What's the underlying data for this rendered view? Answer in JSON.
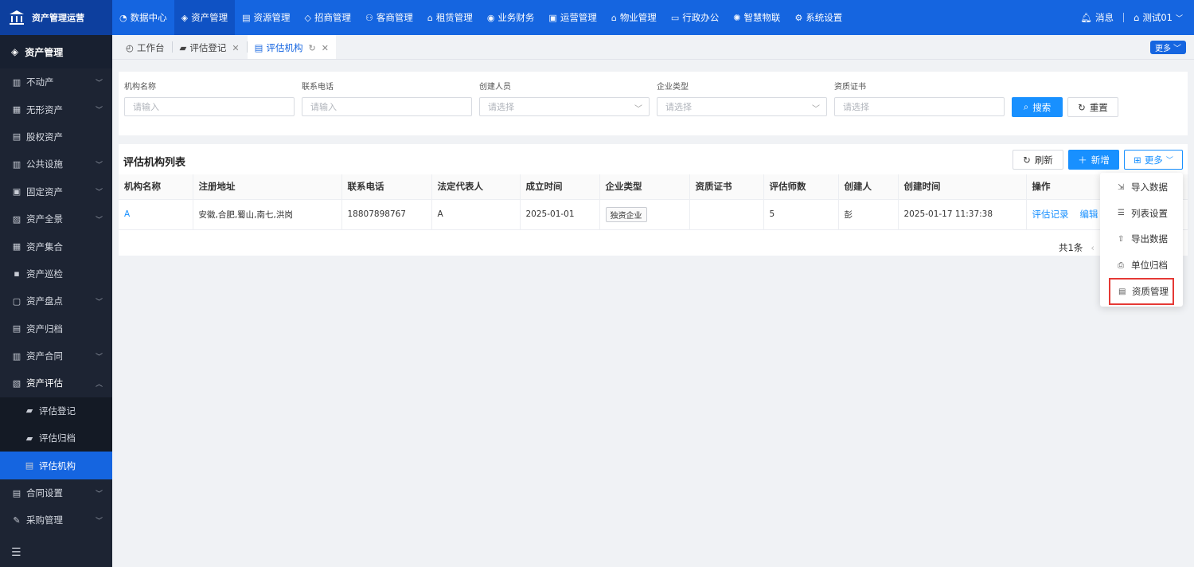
{
  "app": {
    "title": "资产管理运营"
  },
  "topnav": [
    {
      "label": "数据中心",
      "icon": "◔",
      "active": false
    },
    {
      "label": "资产管理",
      "icon": "◈",
      "active": true
    },
    {
      "label": "资源管理",
      "icon": "▤",
      "active": false
    },
    {
      "label": "招商管理",
      "icon": "◇",
      "active": false
    },
    {
      "label": "客商管理",
      "icon": "⚇",
      "active": false
    },
    {
      "label": "租赁管理",
      "icon": "⌂",
      "active": false
    },
    {
      "label": "业务财务",
      "icon": "◉",
      "active": false
    },
    {
      "label": "运营管理",
      "icon": "▣",
      "active": false
    },
    {
      "label": "物业管理",
      "icon": "⌂",
      "active": false
    },
    {
      "label": "行政办公",
      "icon": "▭",
      "active": false
    },
    {
      "label": "智慧物联",
      "icon": "✺",
      "active": false
    },
    {
      "label": "系统设置",
      "icon": "⚙",
      "active": false
    }
  ],
  "header_right": {
    "messages": "消息",
    "user": "测试01"
  },
  "sidebar": {
    "header": "资产管理",
    "items": [
      {
        "label": "不动产",
        "icon": "▥",
        "chevron": "﹀",
        "sub": false
      },
      {
        "label": "无形资产",
        "icon": "▦",
        "chevron": "﹀",
        "sub": false
      },
      {
        "label": "股权资产",
        "icon": "▤",
        "chevron": "",
        "sub": false
      },
      {
        "label": "公共设施",
        "icon": "▥",
        "chevron": "﹀",
        "sub": false
      },
      {
        "label": "固定资产",
        "icon": "▣",
        "chevron": "﹀",
        "sub": false
      },
      {
        "label": "资产全景",
        "icon": "▨",
        "chevron": "﹀",
        "sub": false
      },
      {
        "label": "资产集合",
        "icon": "▦",
        "chevron": "",
        "sub": false
      },
      {
        "label": "资产巡检",
        "icon": "▪",
        "chevron": "",
        "sub": false
      },
      {
        "label": "资产盘点",
        "icon": "▢",
        "chevron": "﹀",
        "sub": false
      },
      {
        "label": "资产归档",
        "icon": "▤",
        "chevron": "",
        "sub": false
      },
      {
        "label": "资产合同",
        "icon": "▥",
        "chevron": "﹀",
        "sub": false
      },
      {
        "label": "资产评估",
        "icon": "▧",
        "chevron": "︿",
        "sub": false,
        "open": true
      },
      {
        "label": "评估登记",
        "icon": "▰",
        "chevron": "",
        "sub": true
      },
      {
        "label": "评估归档",
        "icon": "▰",
        "chevron": "",
        "sub": true
      },
      {
        "label": "评估机构",
        "icon": "▤",
        "chevron": "",
        "sub": true,
        "active": true
      },
      {
        "label": "合同设置",
        "icon": "▤",
        "chevron": "﹀",
        "sub": false
      },
      {
        "label": "采购管理",
        "icon": "✎",
        "chevron": "﹀",
        "sub": false
      }
    ]
  },
  "tabs": [
    {
      "label": "工作台",
      "icon": "◴",
      "closable": false,
      "active": false
    },
    {
      "label": "评估登记",
      "icon": "▰",
      "closable": true,
      "active": false
    },
    {
      "label": "评估机构",
      "icon": "▤",
      "closable": true,
      "active": true
    }
  ],
  "tabbar_more": "更多",
  "search": {
    "fields": [
      {
        "label": "机构名称",
        "placeholder": "请输入",
        "select": false
      },
      {
        "label": "联系电话",
        "placeholder": "请输入",
        "select": false
      },
      {
        "label": "创建人员",
        "placeholder": "请选择",
        "select": true
      },
      {
        "label": "企业类型",
        "placeholder": "请选择",
        "select": true
      },
      {
        "label": "资质证书",
        "placeholder": "请选择",
        "select": false
      }
    ],
    "search_label": "搜索",
    "reset_label": "重置"
  },
  "list": {
    "title": "评估机构列表",
    "refresh_label": "刷新",
    "add_label": "新增",
    "more_label": "更多",
    "columns": [
      "机构名称",
      "注册地址",
      "联系电话",
      "法定代表人",
      "成立时间",
      "企业类型",
      "资质证书",
      "评估师数",
      "创建人",
      "创建时间",
      "操作"
    ],
    "rows": [
      {
        "name": "A",
        "address": "安徽,合肥,蜀山,南七,洪岗",
        "phone": "18807898767",
        "legal_rep": "A",
        "founded": "2025-01-01",
        "company_type": "独资企业",
        "certificate": "",
        "appraisers": "5",
        "creator": "彭",
        "created_at": "2025-01-17 11:37:38",
        "op_record": "评估记录",
        "op_edit": "编辑"
      }
    ],
    "total": "共1条"
  },
  "dropdown": [
    {
      "label": "导入数据",
      "icon": "⇲"
    },
    {
      "label": "列表设置",
      "icon": "☰"
    },
    {
      "label": "导出数据",
      "icon": "⇧"
    },
    {
      "label": "单位归档",
      "icon": "⎙"
    },
    {
      "label": "资质管理",
      "icon": "▤",
      "highlight": true
    }
  ]
}
